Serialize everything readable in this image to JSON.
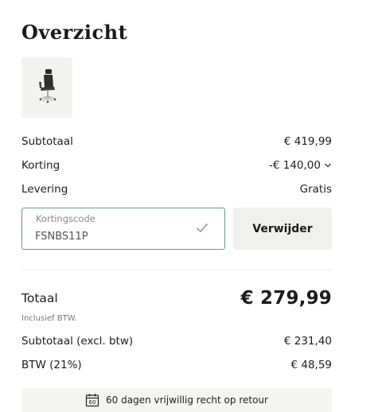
{
  "overview": {
    "title": "Overzicht"
  },
  "product": {
    "image_icon": "office-chair-icon"
  },
  "summary": {
    "subtotal_label": "Subtotaal",
    "subtotal_value": "€ 419,99",
    "discount_label": "Korting",
    "discount_value": "-€ 140,00",
    "discount_toggle_icon": "chevron-down-icon",
    "chevron": "⌄",
    "delivery_label": "Levering",
    "delivery_value": "Gratis"
  },
  "coupon": {
    "label": "Kortingscode",
    "code": "FSNBS11P",
    "status_icon": "checkmark-icon",
    "remove_label": "Verwijder"
  },
  "totals": {
    "total_label": "Totaal",
    "total_value": "€ 279,99",
    "vat_note": "Inclusief BTW.",
    "subtotal_excl_label": "Subtotaal (excl. btw)",
    "subtotal_excl_value": "€ 231,40",
    "vat_label": "BTW (21%)",
    "vat_value": "€ 48,59"
  },
  "retour": {
    "icon": "calendar-icon",
    "icon_number": "60",
    "text": "60 dagen vrijwillig recht op retour"
  },
  "colors": {
    "accent_border": "#6a9a7e",
    "button_bg": "#f0f0ee",
    "banner_bg": "#f4f4f2"
  }
}
